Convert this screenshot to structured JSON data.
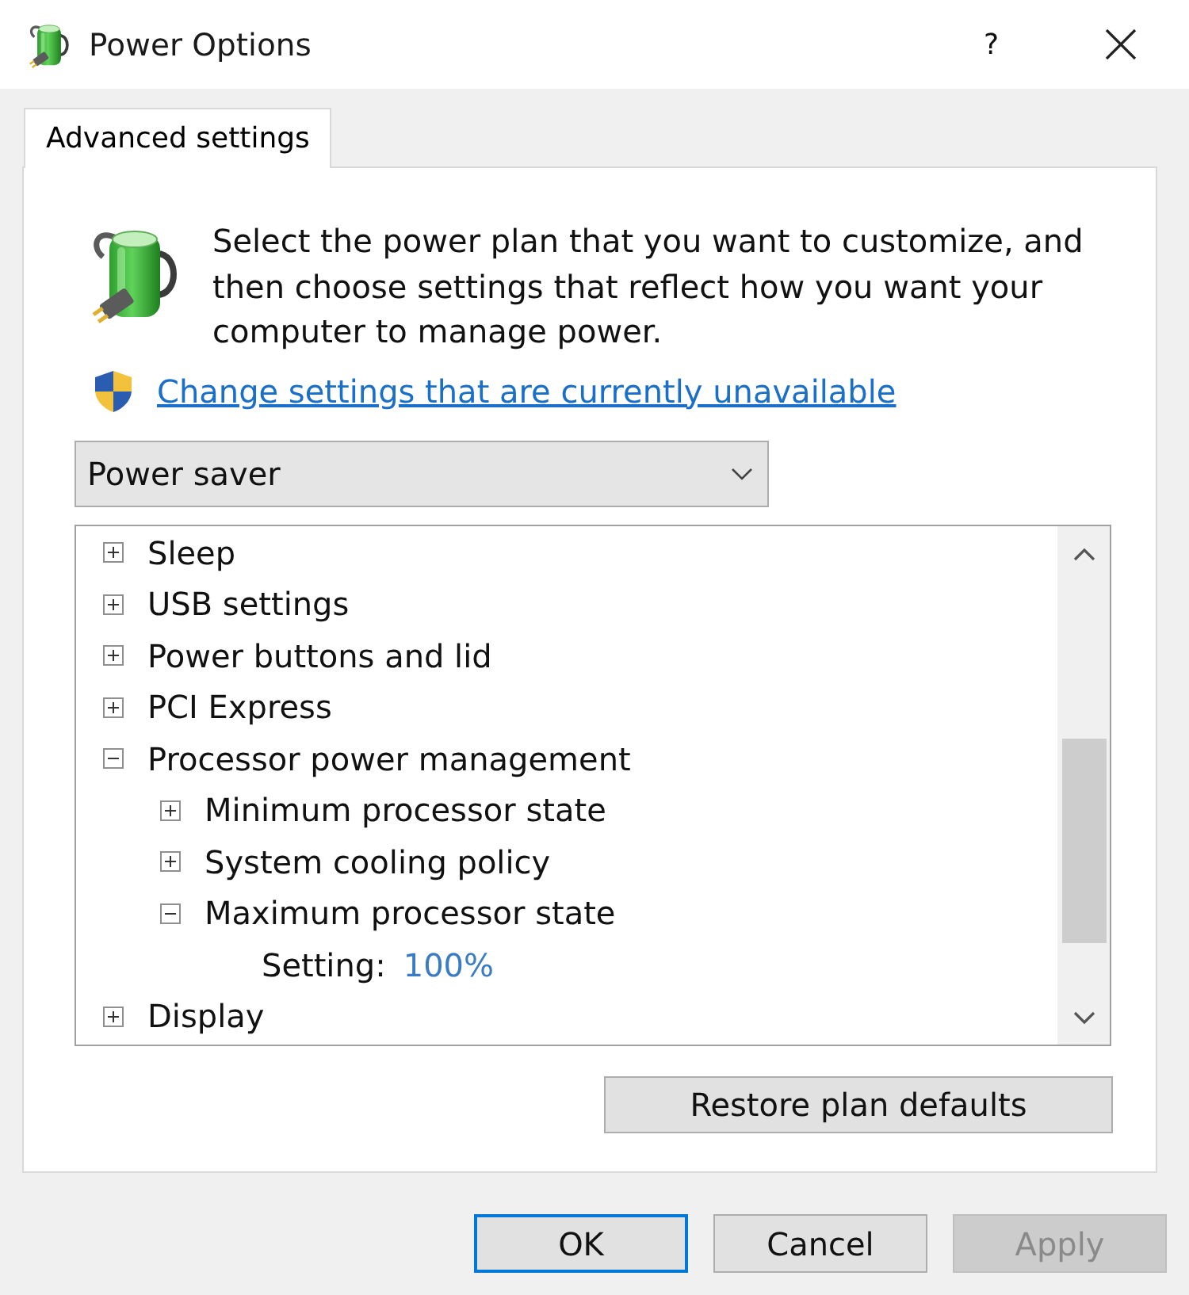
{
  "window": {
    "title": "Power Options",
    "help": "?"
  },
  "tabs": [
    {
      "label": "Advanced settings",
      "selected": true
    }
  ],
  "intro": {
    "text": "Select the power plan that you want to customize, and then choose settings that reflect how you want your computer to manage power.",
    "link": "Change settings that are currently unavailable"
  },
  "plan_select": {
    "value": "Power saver"
  },
  "settings_tree": [
    {
      "kind": "group",
      "label": "Sleep",
      "expanded": false
    },
    {
      "kind": "group",
      "label": "USB settings",
      "expanded": false
    },
    {
      "kind": "group",
      "label": "Power buttons and lid",
      "expanded": false
    },
    {
      "kind": "group",
      "label": "PCI Express",
      "expanded": false
    },
    {
      "kind": "group",
      "label": "Processor power management",
      "expanded": true,
      "children": [
        {
          "kind": "group",
          "label": "Minimum processor state",
          "expanded": false
        },
        {
          "kind": "group",
          "label": "System cooling policy",
          "expanded": false
        },
        {
          "kind": "group",
          "label": "Maximum processor state",
          "expanded": true,
          "children": [
            {
              "kind": "setting",
              "label": "Setting:",
              "value": "100%"
            }
          ]
        }
      ]
    },
    {
      "kind": "group",
      "label": "Display",
      "expanded": false
    }
  ],
  "restore_button": {
    "label": "Restore plan defaults"
  },
  "buttons": [
    {
      "label": "OK",
      "default": true,
      "disabled": false
    },
    {
      "label": "Cancel",
      "default": false,
      "disabled": false
    },
    {
      "label": "Apply",
      "default": false,
      "disabled": true
    }
  ]
}
